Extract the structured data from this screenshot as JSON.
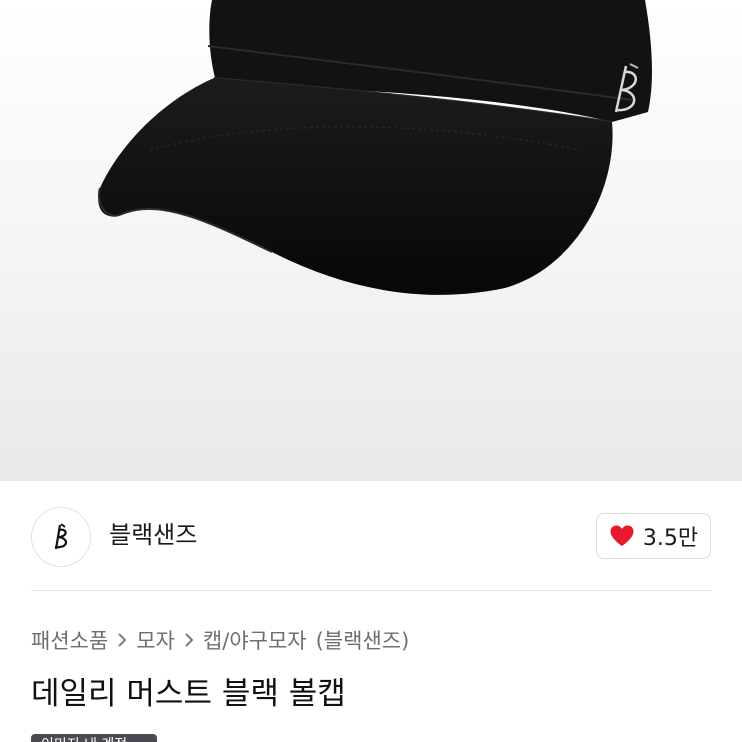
{
  "product_image": {
    "subject": "black baseball cap"
  },
  "brand": {
    "logo_glyph": "B",
    "name": "블랙샌즈",
    "logo_icon": "brand-logo-icon"
  },
  "like": {
    "icon": "heart-icon",
    "count": "3.5만",
    "color": "#e8192c"
  },
  "breadcrumb": {
    "items": [
      "패션소품",
      "모자",
      "캡/야구모자"
    ],
    "brand_suffix": "(블랙샌즈)",
    "separator_icon": "chevron-right-icon"
  },
  "product": {
    "title": "데일리 머스트 블랙 볼캡",
    "badge": "이미지 내 계정"
  }
}
